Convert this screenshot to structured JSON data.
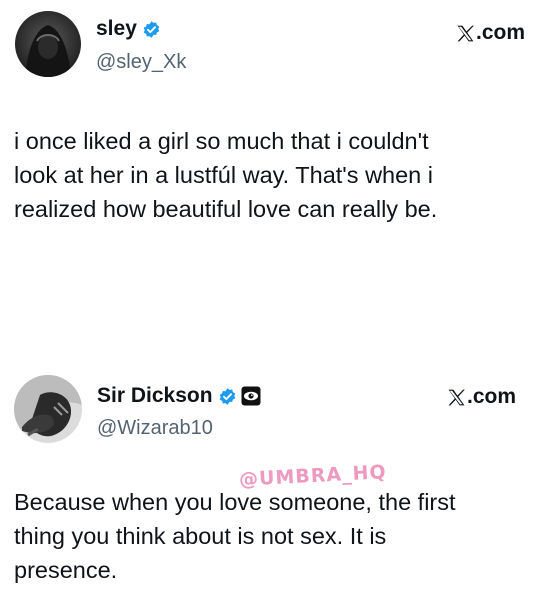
{
  "tweets": [
    {
      "display_name": "sley",
      "handle": "@sley_Xk",
      "source": ".com",
      "text": "i once liked a girl so much that i couldn't\nlook at her in a lustfúl way. That's when i\nrealized how beautiful love can really be.",
      "verified": true,
      "avatar_icon": "hooded-figure-avatar"
    },
    {
      "display_name": "Sir Dickson",
      "handle": "@Wizarab10",
      "source": ".com",
      "text": "Because when you love someone, the first\nthing you think about is not sex. It is\npresence.",
      "verified": true,
      "extra_badge_icon": "eye-badge-icon",
      "avatar_icon": "dark-sketch-avatar"
    }
  ],
  "watermark": "@UMBRA_HQ",
  "colors": {
    "text": "#0f1419",
    "secondary_text": "#536471",
    "verified_blue": "#1d9bf0",
    "watermark": "#de468c"
  }
}
